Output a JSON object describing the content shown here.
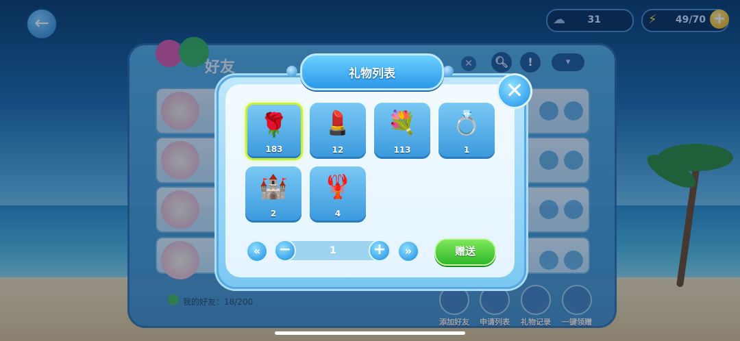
{
  "top_bar": {
    "back_icon": "arrow-left-icon",
    "resource1": {
      "icon": "cloud-icon",
      "value": "31"
    },
    "resource2": {
      "icon": "lightning-icon",
      "value": "49/70"
    },
    "add_icon": "plus-icon"
  },
  "friend_panel": {
    "title": "好友",
    "count_label": "我的好友：18/200",
    "buttons": [
      {
        "label": "添加好友"
      },
      {
        "label": "申请列表"
      },
      {
        "label": "礼物记录"
      },
      {
        "label": "一键领赠"
      }
    ]
  },
  "gift_dialog": {
    "title": "礼物列表",
    "gifts": [
      {
        "icon": "rose-icon",
        "glyph": "🌹",
        "count": "183",
        "selected": true
      },
      {
        "icon": "lipstick-icon",
        "glyph": "💄",
        "count": "12",
        "selected": false
      },
      {
        "icon": "bouquet-icon",
        "glyph": "💐",
        "count": "113",
        "selected": false
      },
      {
        "icon": "ring-box-icon",
        "glyph": "💍",
        "count": "1",
        "selected": false
      },
      {
        "icon": "castle-icon",
        "glyph": "🏰",
        "count": "2",
        "selected": false
      },
      {
        "icon": "lobster-icon",
        "glyph": "🦞",
        "count": "4",
        "selected": false
      }
    ],
    "quantity": "1",
    "send_label": "赠送"
  }
}
